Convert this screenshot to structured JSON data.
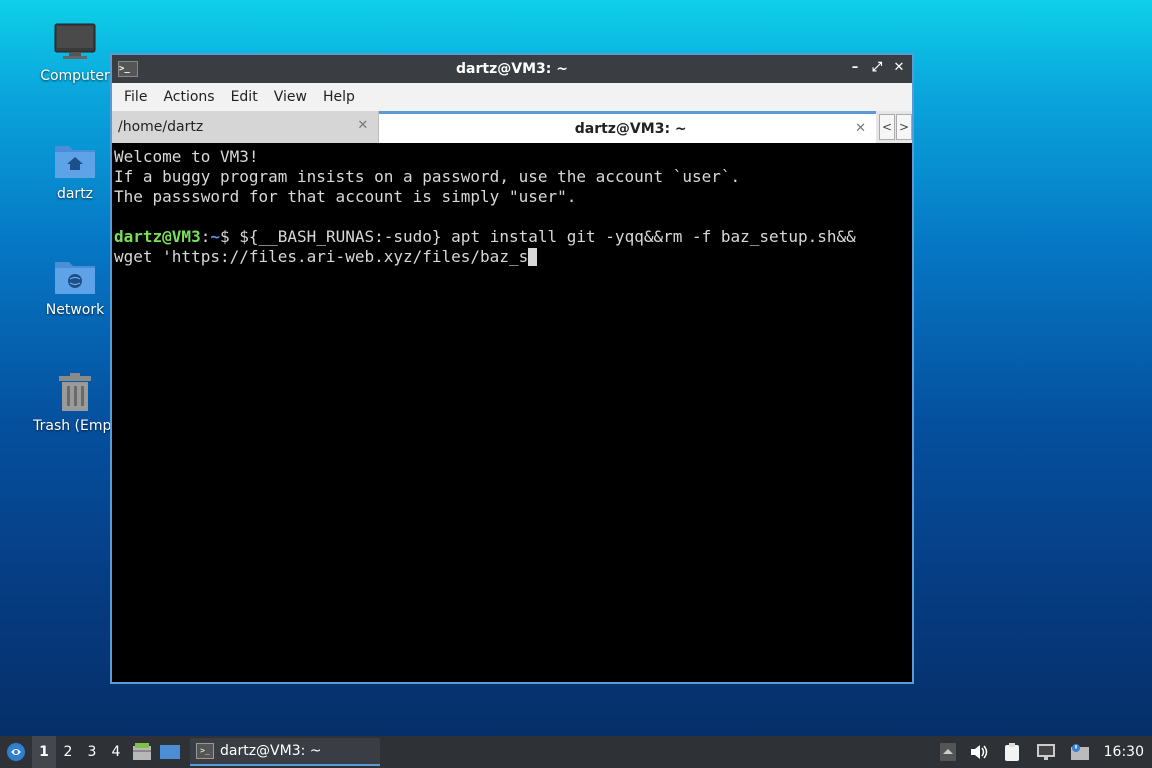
{
  "desktop": {
    "icons": [
      {
        "label": "Computer"
      },
      {
        "label": "dartz"
      },
      {
        "label": "Network"
      },
      {
        "label": "Trash (Empt"
      }
    ]
  },
  "window": {
    "title": "dartz@VM3: ~",
    "term_icon_glyph": ">_",
    "controls": {
      "minimize": "–",
      "maximize": "⤢",
      "close": "✕"
    },
    "menu": [
      "File",
      "Actions",
      "Edit",
      "View",
      "Help"
    ],
    "tabs": [
      {
        "label": "/home/dartz",
        "close": "✕"
      },
      {
        "label": "dartz@VM3: ~",
        "close": "✕"
      }
    ],
    "tab_scroll": {
      "left": "<",
      "right": ">"
    }
  },
  "terminal": {
    "lines": [
      "Welcome to VM3!",
      "If a buggy program insists on a password, use the account `user`.",
      "The passsword for that account is simply \"user\".",
      ""
    ],
    "prompt_user": "dartz@VM3",
    "prompt_sep": ":",
    "prompt_path": "~",
    "prompt_symbol": "$ ",
    "command_line1": "${__BASH_RUNAS:-sudo} apt install git -yqq&&rm -f baz_setup.sh&&",
    "command_line2": "wget 'https://files.ari-web.xyz/files/baz_s"
  },
  "taskbar": {
    "workspaces": [
      "1",
      "2",
      "3",
      "4"
    ],
    "task_label": "dartz@VM3: ~",
    "clock": "16:30"
  },
  "colors": {
    "accent": "#5b9bd5",
    "prompt_user": "#78e05a",
    "prompt_path": "#5b8fe6"
  }
}
